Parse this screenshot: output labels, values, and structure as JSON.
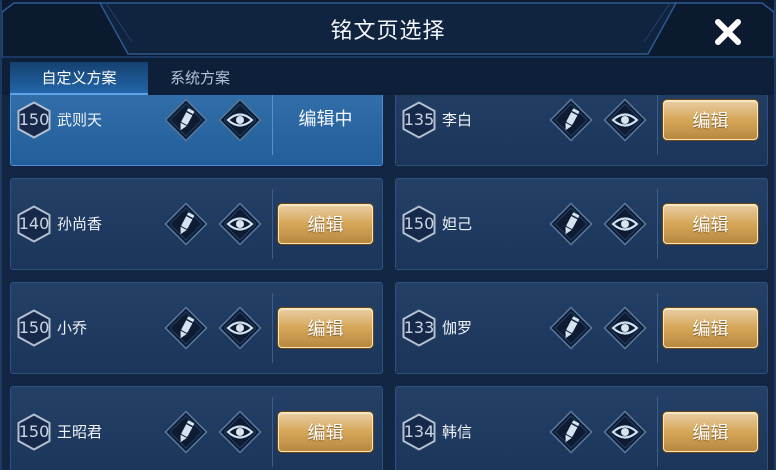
{
  "dialog": {
    "title": "铭文页选择"
  },
  "tabs": [
    {
      "label": "自定义方案",
      "active": true
    },
    {
      "label": "系统方案",
      "active": false
    }
  ],
  "pages": [
    {
      "level": 150,
      "hero": "武则天",
      "action": "编辑中",
      "selected": true
    },
    {
      "level": 135,
      "hero": "李白",
      "action": "编辑",
      "selected": false
    },
    {
      "level": 140,
      "hero": "孙尚香",
      "action": "编辑",
      "selected": false
    },
    {
      "level": 150,
      "hero": "妲己",
      "action": "编辑",
      "selected": false
    },
    {
      "level": 150,
      "hero": "小乔",
      "action": "编辑",
      "selected": false
    },
    {
      "level": 133,
      "hero": "伽罗",
      "action": "编辑",
      "selected": false
    },
    {
      "level": 150,
      "hero": "王昭君",
      "action": "编辑",
      "selected": false
    },
    {
      "level": 134,
      "hero": "韩信",
      "action": "编辑",
      "selected": false
    }
  ],
  "icons": {
    "close": "close-icon",
    "level_badge": "hexagon-icon",
    "rename": "pencil-icon",
    "preview": "eye-icon"
  },
  "theme": {
    "background": "#132745",
    "card": "#1c3860",
    "card_selected": "#2566a7",
    "gold_button": "#d6a658",
    "icon": "#d4e2f1"
  }
}
